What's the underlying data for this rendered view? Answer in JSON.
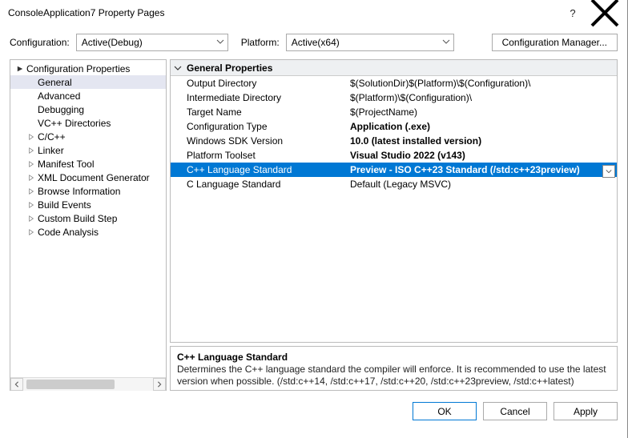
{
  "window": {
    "title": "ConsoleApplication7 Property Pages"
  },
  "top": {
    "config_label": "Configuration:",
    "config_value": "Active(Debug)",
    "platform_label": "Platform:",
    "platform_value": "Active(x64)",
    "config_manager": "Configuration Manager..."
  },
  "tree": {
    "root": "Configuration Properties",
    "items": [
      "General",
      "Advanced",
      "Debugging",
      "VC++ Directories",
      "C/C++",
      "Linker",
      "Manifest Tool",
      "XML Document Generator",
      "Browse Information",
      "Build Events",
      "Custom Build Step",
      "Code Analysis"
    ]
  },
  "grid": {
    "category": "General Properties",
    "rows": [
      {
        "prop": "Output Directory",
        "val": "$(SolutionDir)$(Platform)\\$(Configuration)\\",
        "bold": false
      },
      {
        "prop": "Intermediate Directory",
        "val": "$(Platform)\\$(Configuration)\\",
        "bold": false
      },
      {
        "prop": "Target Name",
        "val": "$(ProjectName)",
        "bold": false
      },
      {
        "prop": "Configuration Type",
        "val": "Application (.exe)",
        "bold": true
      },
      {
        "prop": "Windows SDK Version",
        "val": "10.0 (latest installed version)",
        "bold": true
      },
      {
        "prop": "Platform Toolset",
        "val": "Visual Studio 2022 (v143)",
        "bold": true
      },
      {
        "prop": "C++ Language Standard",
        "val": "Preview - ISO C++23 Standard (/std:c++23preview)",
        "bold": true,
        "selected": true,
        "dropdown": true
      },
      {
        "prop": "C Language Standard",
        "val": "Default (Legacy MSVC)",
        "bold": false
      }
    ]
  },
  "desc": {
    "title": "C++ Language Standard",
    "text": "Determines the C++ language standard the compiler will enforce. It is recommended to use the latest version when possible.  (/std:c++14, /std:c++17, /std:c++20, /std:c++23preview, /std:c++latest)"
  },
  "footer": {
    "ok": "OK",
    "cancel": "Cancel",
    "apply": "Apply"
  }
}
